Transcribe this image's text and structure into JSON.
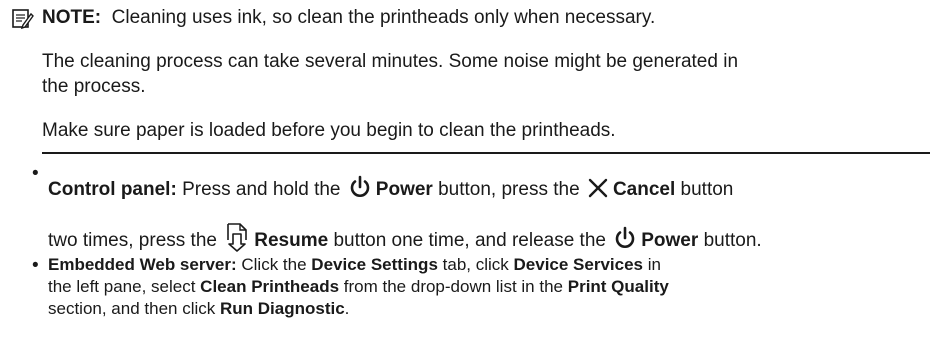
{
  "note": {
    "label": "NOTE:",
    "line1": "Cleaning uses ink, so clean the printheads only when necessary.",
    "para2_line1": "The cleaning process can take several minutes. Some noise might be generated in",
    "para2_line2": "the process.",
    "para3": "Make sure paper is loaded before you begin to clean the printheads."
  },
  "control_panel": {
    "label": "Control panel:",
    "t1": "Press and hold the",
    "power": "Power",
    "t2": "button, press the",
    "cancel": "Cancel",
    "t3": "button",
    "t4": "two times, press the",
    "resume": "Resume",
    "t5": "button one time, and release the",
    "power2": "Power",
    "t6": "button."
  },
  "ews": {
    "label": "Embedded Web server:",
    "t1": "Click the",
    "device_settings": "Device Settings",
    "t2": "tab, click",
    "device_services": "Device Services",
    "t3": "in",
    "t4": "the left pane, select",
    "clean_printheads": "Clean Printheads",
    "t5": "from the drop-down list in the",
    "print_quality": "Print Quality",
    "t6": "section, and then click",
    "run_diagnostic": "Run Diagnostic",
    "t7": "."
  },
  "icons": {
    "note": "note-icon",
    "power": "power-icon",
    "cancel": "cancel-x-icon",
    "resume": "resume-icon"
  }
}
